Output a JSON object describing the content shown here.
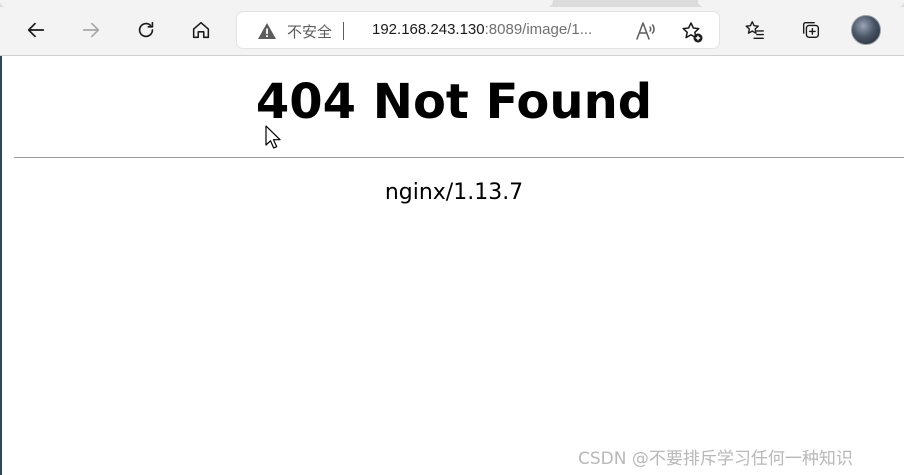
{
  "browser": {
    "nav": {
      "back": "back-arrow-icon",
      "forward": "forward-arrow-icon",
      "refresh": "refresh-icon",
      "home": "home-icon"
    },
    "address_bar": {
      "security_label": "不安全",
      "url_host": "192.168.243.130",
      "url_rest": ":8089/image/1..."
    },
    "toolbar_right": {
      "favorites": "favorites-list-icon",
      "collections": "collections-icon",
      "profile": "profile-avatar"
    }
  },
  "page": {
    "title": "404 Not Found",
    "server": "nginx/1.13.7"
  },
  "watermark": "CSDN @不要排斥学习任何一种知识",
  "colors": {
    "toolbar_bg": "#f3f3f3",
    "page_bg": "#ffffff",
    "text": "#000000"
  }
}
